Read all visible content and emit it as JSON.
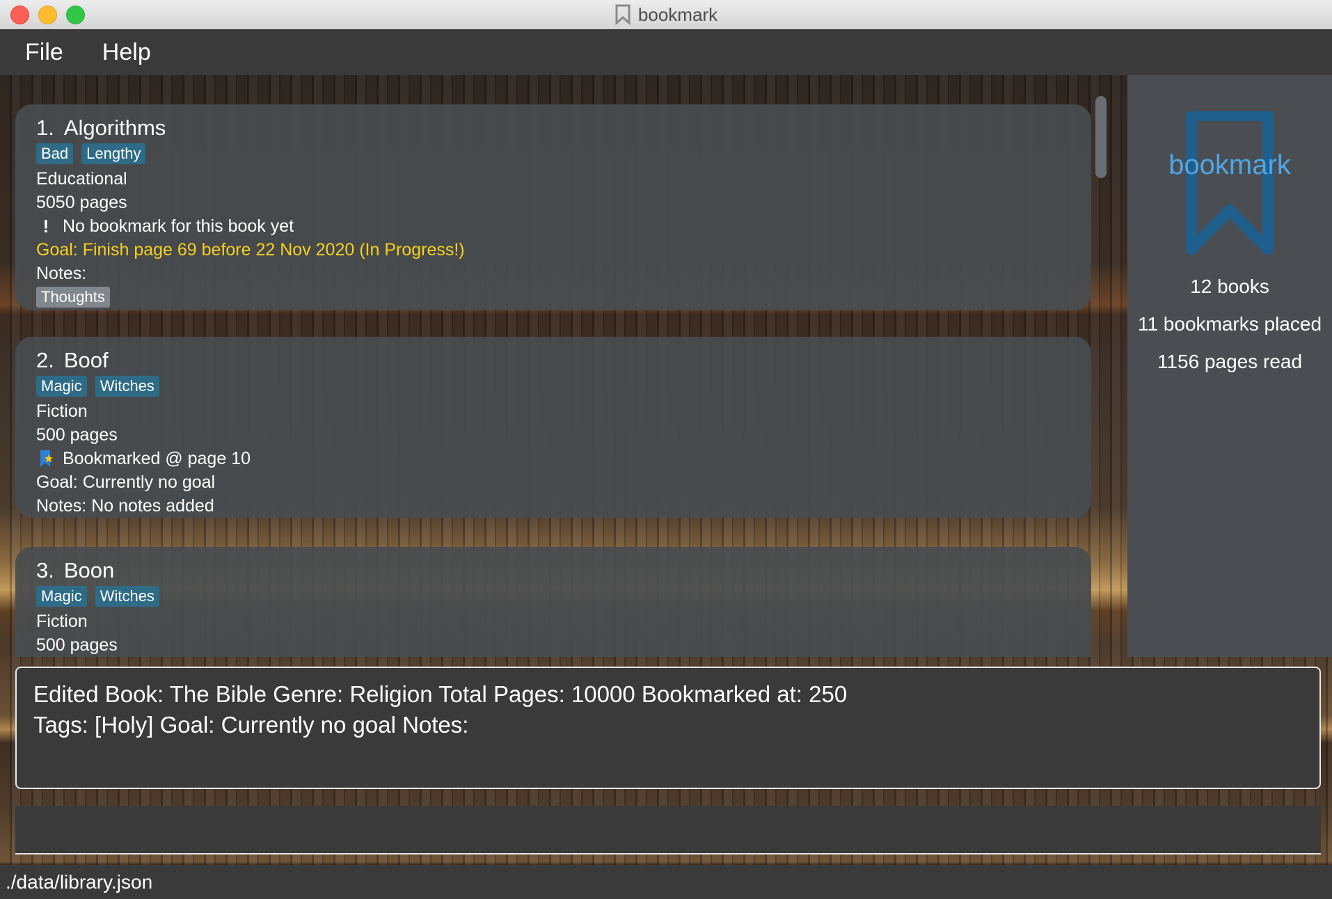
{
  "window": {
    "title": "bookmark",
    "title_icon": "bookmark-outline-icon"
  },
  "menu": {
    "items": [
      "File",
      "Help"
    ]
  },
  "books": [
    {
      "index": "1.",
      "name": "Algorithms",
      "tags": [
        "Bad",
        "Lengthy"
      ],
      "genre": "Educational",
      "pages": "5050 pages",
      "bookmark": "No bookmark for this book yet",
      "bookmark_icon": "exclamation-icon",
      "goal": "Goal: Finish page 69 before 22 Nov 2020 (In Progress!)",
      "goal_color": "#f5d020",
      "notes_label": "Notes:",
      "notes": [
        "Thoughts"
      ]
    },
    {
      "index": "2.",
      "name": "Boof",
      "tags": [
        "Magic",
        "Witches"
      ],
      "genre": "Fiction",
      "pages": "500 pages",
      "bookmark": "Bookmarked @ page 10",
      "bookmark_icon": "bookmark-star-icon",
      "goal": "Goal: Currently no goal",
      "notes_line": "Notes: No notes added"
    },
    {
      "index": "3.",
      "name": "Boon",
      "tags": [
        "Magic",
        "Witches"
      ],
      "genre": "Fiction",
      "pages": "500 pages"
    }
  ],
  "stats": {
    "logo_text": "bookmark",
    "books": "12 books",
    "bookmarks": "11 bookmarks placed",
    "pages_read": "1156 pages read"
  },
  "result": {
    "line1": "Edited Book: The Bible Genre: Religion Total Pages: 10000 Bookmarked at: 250",
    "line2": "Tags: [Holy] Goal: Currently no goal Notes:"
  },
  "command": {
    "value": "",
    "placeholder": ""
  },
  "status": {
    "path": "./data/library.json"
  },
  "colors": {
    "accent": "#4fa6e6",
    "tag": "#2e6b86",
    "goal_active": "#f5d020"
  }
}
